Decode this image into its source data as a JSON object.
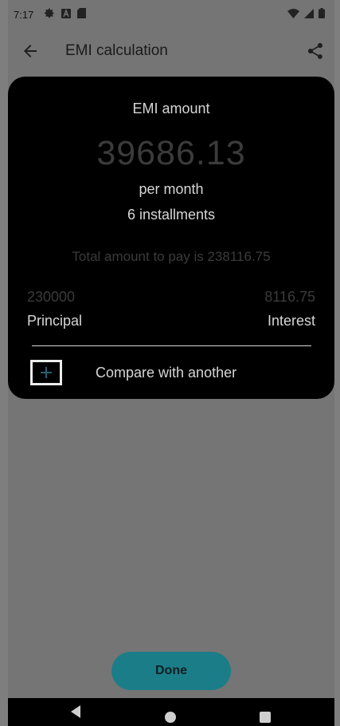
{
  "status_bar": {
    "time": "7:17",
    "icons_left": [
      "gear-icon",
      "a-badge-icon",
      "sd-card-icon"
    ],
    "icons_right": [
      "wifi-icon",
      "signal-icon",
      "battery-icon"
    ]
  },
  "toolbar": {
    "title": "EMI calculation",
    "back_icon": "arrow-back-icon",
    "share_icon": "share-icon"
  },
  "result": {
    "emi_label": "EMI amount",
    "emi_value": "39686.13",
    "per_month": "per month",
    "installments": "6 installments",
    "total_text": "Total amount to pay is 238116.75",
    "principal_value": "230000",
    "principal_label": "Principal",
    "interest_value": "8116.75",
    "interest_label": "Interest",
    "compare_label": "Compare with another"
  },
  "actions": {
    "done_label": "Done"
  },
  "colors": {
    "card_background": "#000000",
    "scrim": "#757575",
    "done_button": "#1b7d88"
  }
}
